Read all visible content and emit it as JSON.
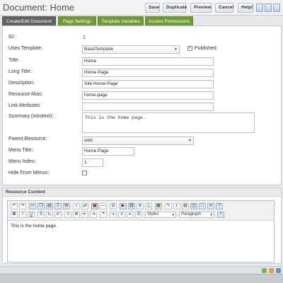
{
  "header": {
    "title": "Document: Home",
    "buttons": {
      "save": "Save",
      "duplicate": "Duplicate",
      "preview": "Preview",
      "cancel": "Cancel",
      "help": "Help!"
    }
  },
  "tabs": [
    {
      "label": "Create/Edit Document",
      "active": true
    },
    {
      "label": "Page Settings",
      "active": false
    },
    {
      "label": "Template Variables",
      "active": false
    },
    {
      "label": "Access Permissions",
      "active": false
    }
  ],
  "form": {
    "id": {
      "label": "ID:",
      "value": "1"
    },
    "template": {
      "label": "Uses Template:",
      "value": "BaseTemplate"
    },
    "published": {
      "label": "Published",
      "checked": true
    },
    "title": {
      "label": "Title:",
      "value": "Home"
    },
    "long_title": {
      "label": "Long Title:",
      "value": "Home Page"
    },
    "description": {
      "label": "Description:",
      "value": "Site Home Page"
    },
    "alias": {
      "label": "Resource Alias:",
      "value": "home-page"
    },
    "link_attributes": {
      "label": "Link Attributes:",
      "value": ""
    },
    "summary": {
      "label": "Summary (introtext):",
      "value": "This is the home page."
    },
    "parent": {
      "label": "Parent Resource:",
      "value": "web"
    },
    "menu_title": {
      "label": "Menu Title:",
      "value": "Home Page"
    },
    "menu_index": {
      "label": "Menu Index:",
      "value": "1"
    },
    "hide_menus": {
      "label": "Hide From Menus:",
      "checked": false
    }
  },
  "resource_content": {
    "header": "Resource Content",
    "styles_select": "Styles",
    "format_select": "Paragraph",
    "body": "This is the home page."
  },
  "colors": {
    "tab_green": "#6f9c2f",
    "tab_active": "#626262"
  }
}
